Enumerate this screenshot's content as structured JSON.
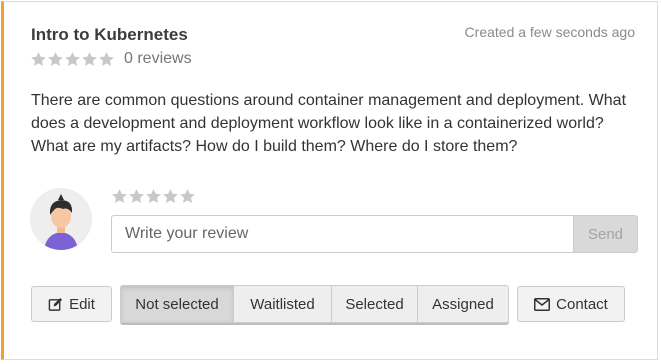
{
  "card": {
    "title": "Intro to Kubernetes",
    "created": "Created a few seconds ago",
    "rating": {
      "value": 0,
      "max": 5,
      "reviews_label": "0 reviews"
    },
    "description": "There are common questions around container management and deployment. What does a development and deployment workflow look like in a containerized world? What are my artifacts? How do I build them? Where do I store them?"
  },
  "review": {
    "stars_max": 5,
    "placeholder": "Write your review",
    "value": "",
    "send_label": "Send"
  },
  "actions": {
    "edit_label": "Edit",
    "status_options": [
      "Not selected",
      "Waitlisted",
      "Selected",
      "Assigned"
    ],
    "selected_status": "Not selected",
    "contact_label": "Contact"
  },
  "colors": {
    "accent_border": "#f0a030",
    "star_empty": "#c8c8c8",
    "button_bg": "#f2f2f2",
    "send_disabled_bg": "#d9d9d9"
  },
  "icons": {
    "edit": "edit-icon",
    "contact": "envelope-icon",
    "avatar": "user-avatar-icon",
    "star": "star-icon"
  }
}
